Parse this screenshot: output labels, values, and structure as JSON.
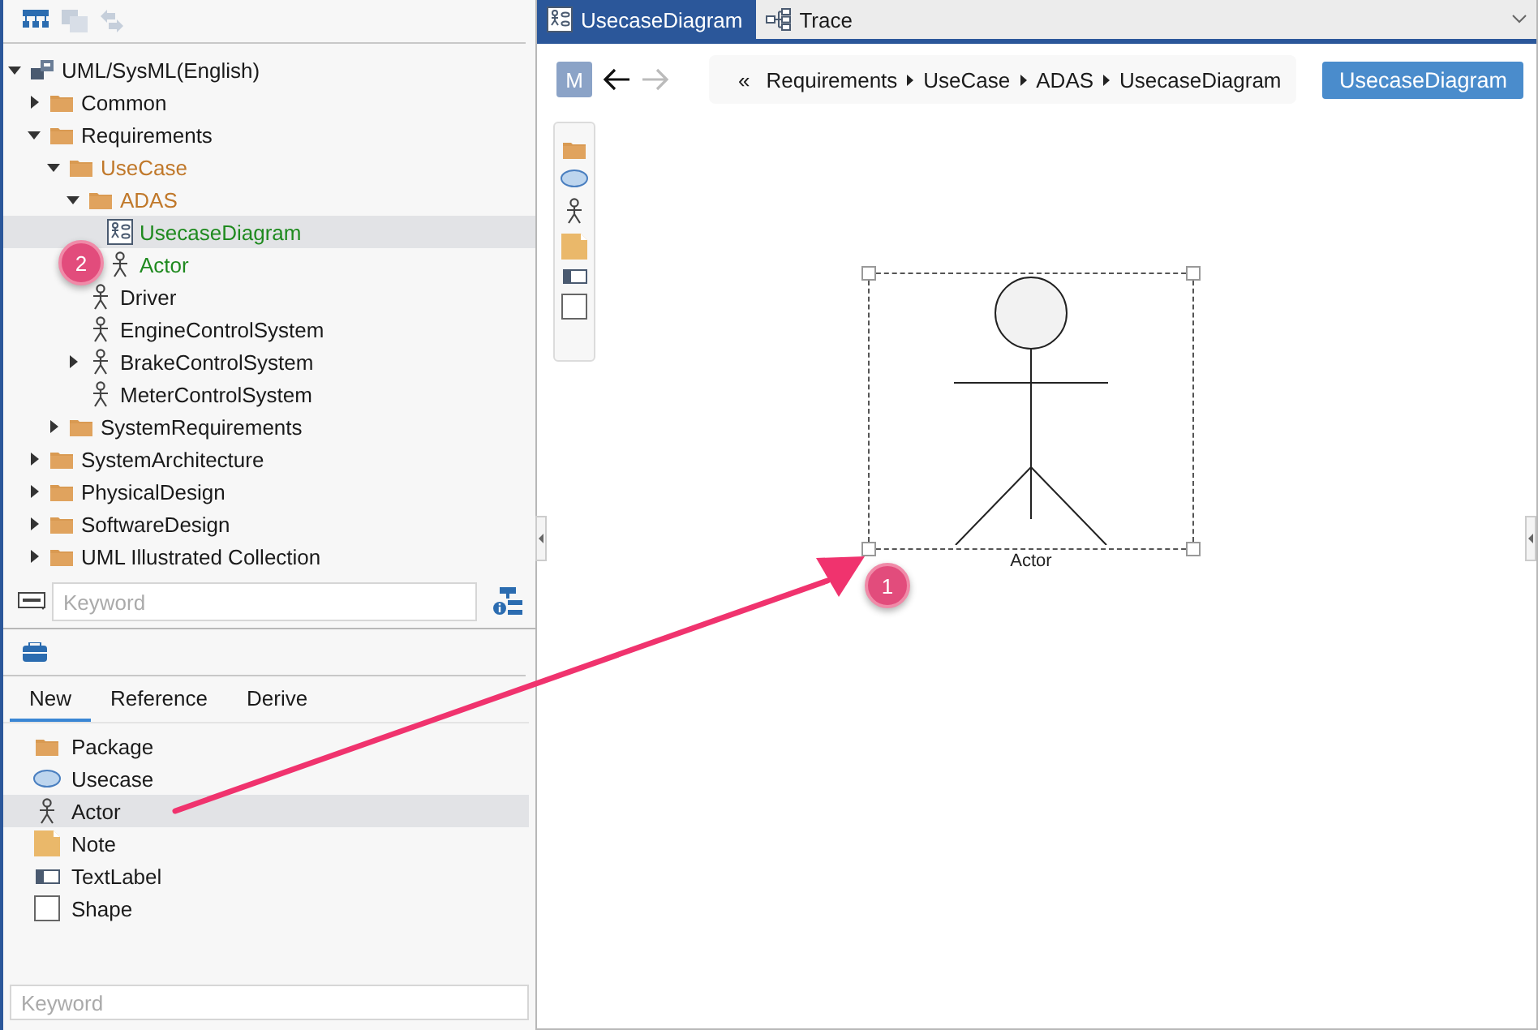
{
  "tree": {
    "items": [
      {
        "label": "UML/SysML(English)",
        "kind": "model",
        "expanded": true,
        "selected": false,
        "color": "#1a1a1a",
        "children": [
          {
            "label": "Common",
            "kind": "folder",
            "expanded": false,
            "selected": false,
            "color": "#1a1a1a"
          },
          {
            "label": "Requirements",
            "kind": "folder",
            "expanded": true,
            "selected": false,
            "color": "#1a1a1a",
            "children": [
              {
                "label": "UseCase",
                "kind": "folder",
                "expanded": true,
                "selected": false,
                "color": "#c0782a",
                "children": [
                  {
                    "label": "ADAS",
                    "kind": "folder",
                    "expanded": true,
                    "selected": false,
                    "color": "#c0782a",
                    "children": [
                      {
                        "label": "UsecaseDiagram",
                        "kind": "diagram",
                        "selected": true,
                        "color": "#1f8a1f"
                      },
                      {
                        "label": "Actor",
                        "kind": "actor",
                        "selected": false,
                        "color": "#1f8a1f"
                      }
                    ]
                  },
                  {
                    "label": "Driver",
                    "kind": "actor",
                    "selected": false,
                    "color": "#1a1a1a"
                  },
                  {
                    "label": "EngineControlSystem",
                    "kind": "actor",
                    "selected": false,
                    "color": "#1a1a1a"
                  },
                  {
                    "label": "BrakeControlSystem",
                    "kind": "actor",
                    "expanded": false,
                    "selected": false,
                    "color": "#1a1a1a"
                  },
                  {
                    "label": "MeterControlSystem",
                    "kind": "actor",
                    "selected": false,
                    "color": "#1a1a1a"
                  }
                ]
              },
              {
                "label": "SystemRequirements",
                "kind": "folder",
                "expanded": false,
                "selected": false,
                "color": "#1a1a1a"
              }
            ]
          },
          {
            "label": "SystemArchitecture",
            "kind": "folder",
            "expanded": false,
            "selected": false,
            "color": "#1a1a1a"
          },
          {
            "label": "PhysicalDesign",
            "kind": "folder",
            "expanded": false,
            "selected": false,
            "color": "#1a1a1a"
          },
          {
            "label": "SoftwareDesign",
            "kind": "folder",
            "expanded": false,
            "selected": false,
            "color": "#1a1a1a"
          },
          {
            "label": "UML Illustrated Collection",
            "kind": "folder",
            "expanded": false,
            "selected": false,
            "color": "#1a1a1a"
          }
        ]
      }
    ],
    "search": {
      "placeholder": "Keyword"
    }
  },
  "toolbox": {
    "tabs": [
      {
        "label": "New",
        "selected": true
      },
      {
        "label": "Reference",
        "selected": false
      },
      {
        "label": "Derive",
        "selected": false
      }
    ],
    "items": [
      {
        "label": "Package",
        "kind": "package",
        "selected": false
      },
      {
        "label": "Usecase",
        "kind": "usecase",
        "selected": false
      },
      {
        "label": "Actor",
        "kind": "actor",
        "selected": true
      },
      {
        "label": "Note",
        "kind": "note",
        "selected": false
      },
      {
        "label": "TextLabel",
        "kind": "textlabel",
        "selected": false
      },
      {
        "label": "Shape",
        "kind": "shape",
        "selected": false
      }
    ],
    "search": {
      "placeholder": "Keyword"
    }
  },
  "editor": {
    "tabs": [
      {
        "label": "UsecaseDiagram",
        "kind": "diagram",
        "selected": true
      },
      {
        "label": "Trace",
        "kind": "trace",
        "selected": false
      }
    ],
    "mode_button": "M",
    "back_symbol": "«",
    "breadcrumb": [
      "Requirements",
      "UseCase",
      "ADAS",
      "UsecaseDiagram"
    ],
    "diagram_button": "UsecaseDiagram",
    "palette": [
      {
        "kind": "package"
      },
      {
        "kind": "usecase"
      },
      {
        "kind": "actor"
      },
      {
        "kind": "note"
      },
      {
        "kind": "textlabel"
      },
      {
        "kind": "shape"
      }
    ],
    "elements": [
      {
        "kind": "actor",
        "label": "Actor",
        "selected": true
      }
    ]
  },
  "annotations": [
    {
      "label": "1"
    },
    {
      "label": "2"
    }
  ]
}
